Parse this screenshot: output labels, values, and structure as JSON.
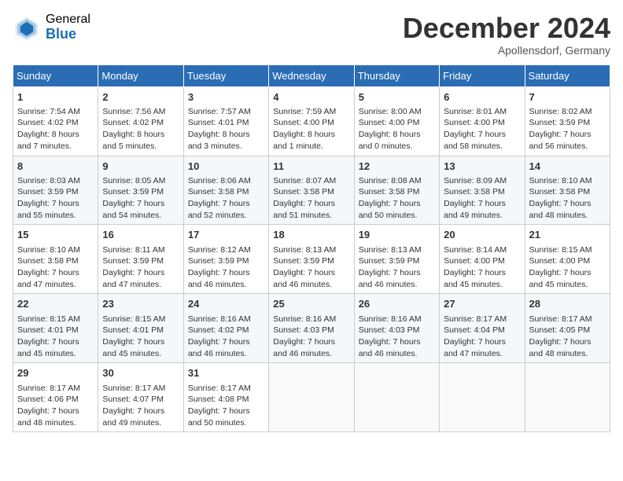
{
  "header": {
    "logo_general": "General",
    "logo_blue": "Blue",
    "month_title": "December 2024",
    "subtitle": "Apollensdorf, Germany"
  },
  "days_of_week": [
    "Sunday",
    "Monday",
    "Tuesday",
    "Wednesday",
    "Thursday",
    "Friday",
    "Saturday"
  ],
  "weeks": [
    [
      {
        "day": "1",
        "info": "Sunrise: 7:54 AM\nSunset: 4:02 PM\nDaylight: 8 hours and 7 minutes."
      },
      {
        "day": "2",
        "info": "Sunrise: 7:56 AM\nSunset: 4:02 PM\nDaylight: 8 hours and 5 minutes."
      },
      {
        "day": "3",
        "info": "Sunrise: 7:57 AM\nSunset: 4:01 PM\nDaylight: 8 hours and 3 minutes."
      },
      {
        "day": "4",
        "info": "Sunrise: 7:59 AM\nSunset: 4:00 PM\nDaylight: 8 hours and 1 minute."
      },
      {
        "day": "5",
        "info": "Sunrise: 8:00 AM\nSunset: 4:00 PM\nDaylight: 8 hours and 0 minutes."
      },
      {
        "day": "6",
        "info": "Sunrise: 8:01 AM\nSunset: 4:00 PM\nDaylight: 7 hours and 58 minutes."
      },
      {
        "day": "7",
        "info": "Sunrise: 8:02 AM\nSunset: 3:59 PM\nDaylight: 7 hours and 56 minutes."
      }
    ],
    [
      {
        "day": "8",
        "info": "Sunrise: 8:03 AM\nSunset: 3:59 PM\nDaylight: 7 hours and 55 minutes."
      },
      {
        "day": "9",
        "info": "Sunrise: 8:05 AM\nSunset: 3:59 PM\nDaylight: 7 hours and 54 minutes."
      },
      {
        "day": "10",
        "info": "Sunrise: 8:06 AM\nSunset: 3:58 PM\nDaylight: 7 hours and 52 minutes."
      },
      {
        "day": "11",
        "info": "Sunrise: 8:07 AM\nSunset: 3:58 PM\nDaylight: 7 hours and 51 minutes."
      },
      {
        "day": "12",
        "info": "Sunrise: 8:08 AM\nSunset: 3:58 PM\nDaylight: 7 hours and 50 minutes."
      },
      {
        "day": "13",
        "info": "Sunrise: 8:09 AM\nSunset: 3:58 PM\nDaylight: 7 hours and 49 minutes."
      },
      {
        "day": "14",
        "info": "Sunrise: 8:10 AM\nSunset: 3:58 PM\nDaylight: 7 hours and 48 minutes."
      }
    ],
    [
      {
        "day": "15",
        "info": "Sunrise: 8:10 AM\nSunset: 3:58 PM\nDaylight: 7 hours and 47 minutes."
      },
      {
        "day": "16",
        "info": "Sunrise: 8:11 AM\nSunset: 3:59 PM\nDaylight: 7 hours and 47 minutes."
      },
      {
        "day": "17",
        "info": "Sunrise: 8:12 AM\nSunset: 3:59 PM\nDaylight: 7 hours and 46 minutes."
      },
      {
        "day": "18",
        "info": "Sunrise: 8:13 AM\nSunset: 3:59 PM\nDaylight: 7 hours and 46 minutes."
      },
      {
        "day": "19",
        "info": "Sunrise: 8:13 AM\nSunset: 3:59 PM\nDaylight: 7 hours and 46 minutes."
      },
      {
        "day": "20",
        "info": "Sunrise: 8:14 AM\nSunset: 4:00 PM\nDaylight: 7 hours and 45 minutes."
      },
      {
        "day": "21",
        "info": "Sunrise: 8:15 AM\nSunset: 4:00 PM\nDaylight: 7 hours and 45 minutes."
      }
    ],
    [
      {
        "day": "22",
        "info": "Sunrise: 8:15 AM\nSunset: 4:01 PM\nDaylight: 7 hours and 45 minutes."
      },
      {
        "day": "23",
        "info": "Sunrise: 8:15 AM\nSunset: 4:01 PM\nDaylight: 7 hours and 45 minutes."
      },
      {
        "day": "24",
        "info": "Sunrise: 8:16 AM\nSunset: 4:02 PM\nDaylight: 7 hours and 46 minutes."
      },
      {
        "day": "25",
        "info": "Sunrise: 8:16 AM\nSunset: 4:03 PM\nDaylight: 7 hours and 46 minutes."
      },
      {
        "day": "26",
        "info": "Sunrise: 8:16 AM\nSunset: 4:03 PM\nDaylight: 7 hours and 46 minutes."
      },
      {
        "day": "27",
        "info": "Sunrise: 8:17 AM\nSunset: 4:04 PM\nDaylight: 7 hours and 47 minutes."
      },
      {
        "day": "28",
        "info": "Sunrise: 8:17 AM\nSunset: 4:05 PM\nDaylight: 7 hours and 48 minutes."
      }
    ],
    [
      {
        "day": "29",
        "info": "Sunrise: 8:17 AM\nSunset: 4:06 PM\nDaylight: 7 hours and 48 minutes."
      },
      {
        "day": "30",
        "info": "Sunrise: 8:17 AM\nSunset: 4:07 PM\nDaylight: 7 hours and 49 minutes."
      },
      {
        "day": "31",
        "info": "Sunrise: 8:17 AM\nSunset: 4:08 PM\nDaylight: 7 hours and 50 minutes."
      },
      {
        "day": "",
        "info": ""
      },
      {
        "day": "",
        "info": ""
      },
      {
        "day": "",
        "info": ""
      },
      {
        "day": "",
        "info": ""
      }
    ]
  ]
}
